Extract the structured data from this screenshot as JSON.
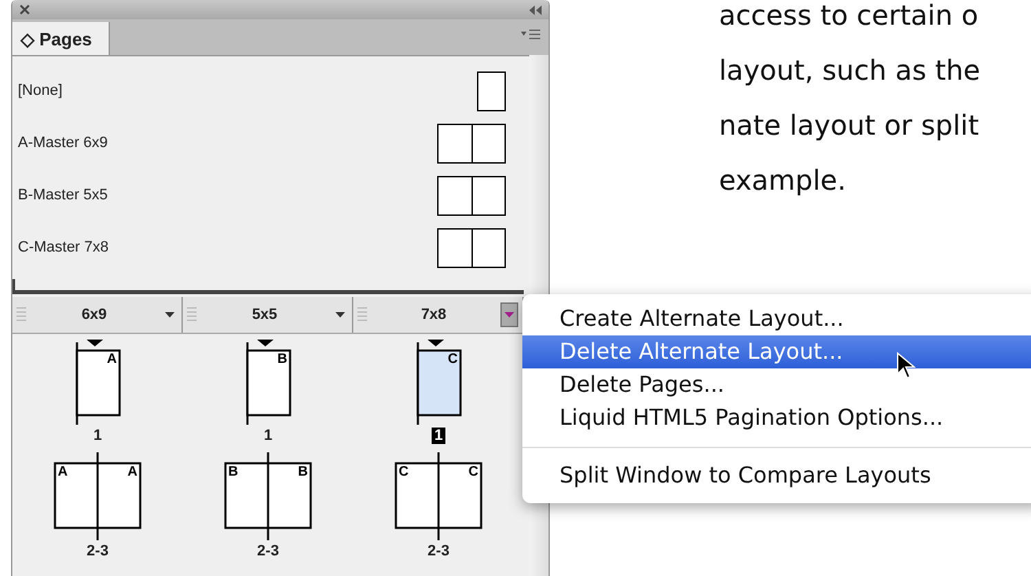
{
  "panel": {
    "tab": {
      "label": "Pages",
      "icon": "◇",
      "selected": true
    },
    "masters": [
      {
        "name": "[None]",
        "kind": "single"
      },
      {
        "name": "A-Master 6x9",
        "kind": "spread"
      },
      {
        "name": "B-Master 5x5",
        "kind": "spread"
      },
      {
        "name": "C-Master 7x8",
        "kind": "spread"
      }
    ],
    "layouts": [
      {
        "label": "6x9",
        "menu_open": false,
        "pages": [
          {
            "kind": "page",
            "masters": [
              "A"
            ],
            "number": "1",
            "selected": false
          },
          {
            "kind": "spread",
            "masters": [
              "A",
              "A"
            ],
            "number": "2-3",
            "selected": false
          }
        ]
      },
      {
        "label": "5x5",
        "menu_open": false,
        "pages": [
          {
            "kind": "page",
            "masters": [
              "B"
            ],
            "number": "1",
            "selected": false
          },
          {
            "kind": "spread",
            "masters": [
              "B",
              "B"
            ],
            "number": "2-3",
            "selected": false
          }
        ]
      },
      {
        "label": "7x8",
        "menu_open": true,
        "pages": [
          {
            "kind": "page",
            "masters": [
              "C"
            ],
            "number": "1",
            "selected": true
          },
          {
            "kind": "spread",
            "masters": [
              "C",
              "C"
            ],
            "number": "2-3",
            "selected": false
          }
        ]
      }
    ]
  },
  "menu": [
    {
      "label": "Create Alternate Layout...",
      "selected": false,
      "separator_before": false
    },
    {
      "label": "Delete Alternate Layout...",
      "selected": true,
      "separator_before": false
    },
    {
      "label": "Delete Pages...",
      "selected": false,
      "separator_before": false
    },
    {
      "label": "Liquid HTML5 Pagination Options...",
      "selected": false,
      "separator_before": false
    },
    {
      "label": "Split Window to Compare Layouts",
      "selected": false,
      "separator_before": true
    }
  ],
  "body_text": [
    "access to certain o",
    "layout, such as the",
    "nate layout or split",
    "example."
  ]
}
